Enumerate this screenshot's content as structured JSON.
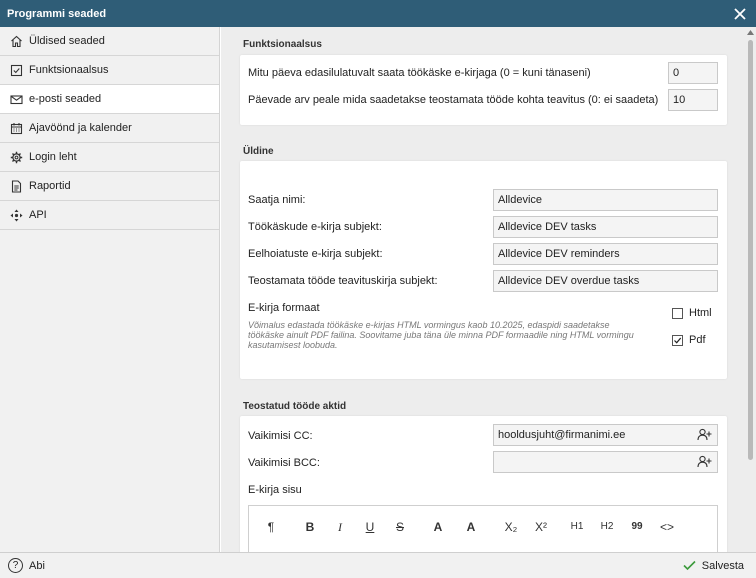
{
  "window": {
    "title": "Programmi seaded",
    "close_icon": "close-icon"
  },
  "sidebar": {
    "items": [
      {
        "label": "Üldised seaded",
        "icon": "home-icon",
        "active": false
      },
      {
        "label": "Funktsionaalsus",
        "icon": "checkbox-icon",
        "active": false
      },
      {
        "label": "e-posti seaded",
        "icon": "envelope-icon",
        "active": true
      },
      {
        "label": "Ajavöönd ja kalender",
        "icon": "calendar-icon",
        "active": false
      },
      {
        "label": "Login leht",
        "icon": "gear-icon",
        "active": false
      },
      {
        "label": "Raportid",
        "icon": "document-icon",
        "active": false
      },
      {
        "label": "API",
        "icon": "move-arrows-icon",
        "active": false
      }
    ]
  },
  "functionality": {
    "title": "Funktsionaalsus",
    "rows": [
      {
        "label": "Mitu päeva edasilulatuvalt saata töökäske e-kirjaga (0 = kuni tänaseni)",
        "value": "0"
      },
      {
        "label": "Päevade arv peale mida saadetakse teostamata tööde kohta teavitus (0: ei saadeta)",
        "value": "10"
      }
    ]
  },
  "general": {
    "title": "Üldine",
    "rows": [
      {
        "label": "Saatja nimi:",
        "value": "Alldevice"
      },
      {
        "label": "Töökäskude e-kirja subjekt:",
        "value": "Alldevice DEV tasks"
      },
      {
        "label": "Eelhoiatuste e-kirja subjekt:",
        "value": "Alldevice DEV reminders"
      },
      {
        "label": "Teostamata tööde teavituskirja subjekt:",
        "value": "Alldevice DEV overdue tasks"
      }
    ],
    "format": {
      "label": "E-kirja formaat",
      "note": "Võimalus edastada töökäske e-kirjas HTML vormingus kaob 10.2025, edaspidi saadetakse töökäske ainult PDF failina. Soovitame juba täna üle minna PDF formaadile ning HTML vormingu kasutamisest loobuda.",
      "options": [
        {
          "label": "Html",
          "checked": false
        },
        {
          "label": "Pdf",
          "checked": true
        }
      ]
    }
  },
  "completed": {
    "title": "Teostatud tööde aktid",
    "cc_label": "Vaikimisi CC:",
    "cc_value": "hooldusjuht@firmanimi.ee",
    "bcc_label": "Vaikimisi BCC:",
    "bcc_value": "",
    "body_label": "E-kirja sisu",
    "toolbar": [
      "¶",
      "B",
      "I",
      "U",
      "S",
      "A",
      "A",
      "X₂",
      "X²",
      "H1",
      "H2",
      "99",
      "<>"
    ]
  },
  "footer": {
    "help_label": "Abi",
    "save_label": "Salvesta"
  }
}
